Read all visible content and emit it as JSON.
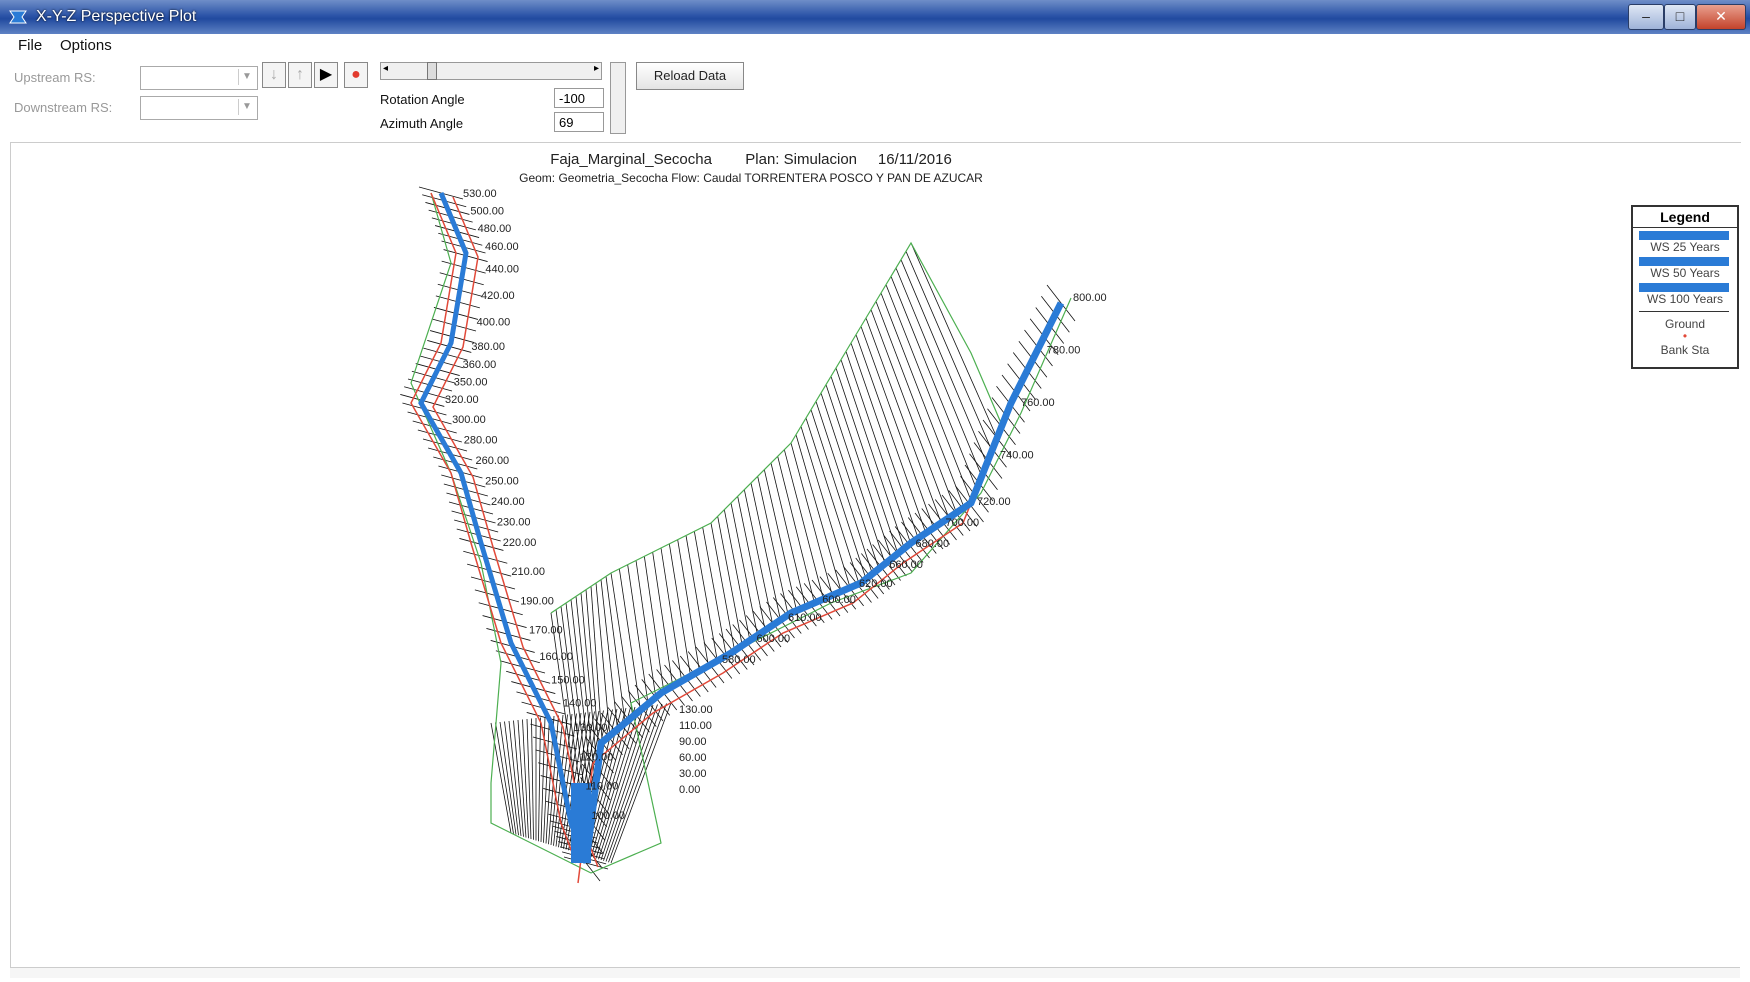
{
  "window": {
    "title": "X-Y-Z Perspective Plot"
  },
  "menu": {
    "file": "File",
    "options": "Options"
  },
  "toolbar": {
    "upstream_label": "Upstream RS:",
    "downstream_label": "Downstream RS:",
    "rotation_label": "Rotation Angle",
    "azimuth_label": "Azimuth Angle",
    "rotation_value": "-100",
    "azimuth_value": "69",
    "reload_label": "Reload Data"
  },
  "plot": {
    "title_line1": "Faja_Marginal_Secocha        Plan: Simulacion     16/11/2016",
    "title_line2": "Geom: Geometria_Secocha    Flow: Caudal TORRENTERA POSCO Y PAN DE AZUCAR"
  },
  "legend": {
    "title": "Legend",
    "items": [
      "WS 25 Years",
      "WS 50 Years",
      "WS 100 Years",
      "Ground",
      "Bank Sta"
    ],
    "colors": {
      "water": "#2a7bd6",
      "ground_line": "#111111",
      "bank": "#e24a3a",
      "outline": "#4caf50"
    }
  },
  "stations_left": [
    "530.00",
    "500.00",
    "480.00",
    "460.00",
    "440.00",
    "420.00",
    "400.00",
    "380.00",
    "360.00",
    "350.00",
    "320.00",
    "300.00",
    "280.00",
    "260.00",
    "250.00",
    "240.00",
    "230.00",
    "220.00",
    "210.00",
    "190.00",
    "170.00",
    "160.00",
    "150.00",
    "140.00",
    "130.00",
    "120.00",
    "110.00",
    "100.00"
  ],
  "stations_right": [
    "800.00",
    "780.00",
    "760.00",
    "740.00",
    "720.00",
    "700.00",
    "680.00",
    "660.00",
    "620.00",
    "600.00",
    "610.00",
    "600.00",
    "580.00"
  ],
  "stations_bottom": [
    "130.00",
    "110.00",
    "90.00",
    "60.00",
    "30.00",
    "0.00"
  ]
}
